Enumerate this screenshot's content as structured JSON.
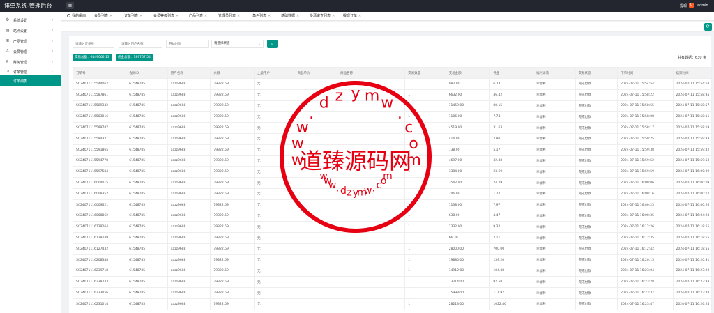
{
  "app": {
    "title": "排单系统-管理后台",
    "notice_label": "提现",
    "notice_count": "0",
    "user": "admin"
  },
  "sidebar": {
    "items": [
      {
        "label": "系统设置",
        "icon": "gear-icon",
        "glyph": "⚙"
      },
      {
        "label": "站点设置",
        "icon": "site-icon",
        "glyph": "▤"
      },
      {
        "label": "产品管理",
        "icon": "product-icon",
        "glyph": "⊞"
      },
      {
        "label": "会员管理",
        "icon": "user-icon",
        "glyph": "♙"
      },
      {
        "label": "财务管理",
        "icon": "finance-icon",
        "glyph": "¥"
      },
      {
        "label": "订单管理",
        "icon": "order-icon",
        "glyph": "⊡"
      }
    ],
    "active_sub": "订单列表"
  },
  "tabs": [
    {
      "label": "我的桌面"
    },
    {
      "label": "会员列表"
    },
    {
      "label": "订单列表"
    },
    {
      "label": "会员等级列表"
    },
    {
      "label": "产品列表"
    },
    {
      "label": "管理员列表"
    },
    {
      "label": "角色列表"
    },
    {
      "label": "基础数据"
    },
    {
      "label": "多源审查列表"
    },
    {
      "label": "提现订单"
    }
  ],
  "filters": {
    "order_no_ph": "请输入订单号",
    "user_ph": "请输入用户名称",
    "time_ph": "开始时间",
    "status_value": "请选择状态"
  },
  "stats": {
    "trade": "交易总额：6449066.13",
    "commission": "佣金总额：189767.54",
    "total": "共有数据：630 条"
  },
  "table": {
    "headers": [
      "订单号",
      "会员ID",
      "用户名称",
      "余额",
      "上级用户",
      "商品单价",
      "商品名称",
      "交易数量",
      "交易金额",
      "佣金",
      "福利详情",
      "交易状态",
      "下单时间",
      "结束时间"
    ],
    "rows": [
      [
        "SC24071115544062",
        "61548785",
        "aazz9688",
        "79322.59",
        "无",
        "",
        "",
        "1",
        "982.00",
        "6.73",
        "幸福利",
        "完成付款",
        "2024-07-11 15:54:54",
        "2024-07-11 15:54:58"
      ],
      [
        "SC24071115587861",
        "61548785",
        "aazz9688",
        "79322.59",
        "无",
        "",
        "",
        "1",
        "6632.00",
        "46.42",
        "幸福利",
        "完成付款",
        "2024-07-11 15:58:22",
        "2024-07-11 15:58:35"
      ],
      [
        "SC24071115589342",
        "61548785",
        "aazz9688",
        "79322.59",
        "无",
        "",
        "",
        "1",
        "11459.00",
        "80.15",
        "幸福利",
        "完成付款",
        "2024-07-11 15:58:55",
        "2024-07-11 15:58:57"
      ],
      [
        "SC24071115583016",
        "61548785",
        "aazz9688",
        "79322.59",
        "无",
        "",
        "",
        "1",
        "1106.00",
        "7.74",
        "幸福利",
        "完成付款",
        "2024-07-11 15:58:08",
        "2024-07-11 15:58:11"
      ],
      [
        "SC24071115589787",
        "61548785",
        "aazz9688",
        "79322.59",
        "无",
        "",
        "",
        "1",
        "4519.00",
        "31.63",
        "幸福利",
        "完成付款",
        "2024-07-11 15:58:17",
        "2024-07-11 15:58:19"
      ],
      [
        "SC24071115594321",
        "61548785",
        "aazz9688",
        "79322.59",
        "无",
        "",
        "",
        "1",
        "414.00",
        "2.90",
        "幸福利",
        "完成付款",
        "2024-07-11 15:59:25",
        "2024-07-11 15:59:33"
      ],
      [
        "SC24071115591865",
        "61548785",
        "aazz9688",
        "79322.59",
        "无",
        "",
        "",
        "1",
        "738.00",
        "5.17",
        "幸福利",
        "完成付款",
        "2024-07-11 15:59:38",
        "2024-07-11 15:59:42"
      ],
      [
        "SC24071115594778",
        "61548785",
        "aazz9688",
        "79322.59",
        "无",
        "",
        "",
        "1",
        "4697.00",
        "32.88",
        "幸福利",
        "完成付款",
        "2024-07-11 15:59:52",
        "2024-07-11 15:59:53"
      ],
      [
        "SC24071115597584",
        "61548785",
        "aazz9688",
        "79322.59",
        "无",
        "",
        "",
        "1",
        "3384.00",
        "23.69",
        "幸福利",
        "完成付款",
        "2024-07-11 15:59:59",
        "2024-07-11 16:00:09"
      ],
      [
        "SC24071116004015",
        "61548785",
        "aazz9688",
        "79322.59",
        "无",
        "",
        "",
        "1",
        "3542.00",
        "24.79",
        "幸福利",
        "完成付款",
        "2024-07-11 16:00:06",
        "2024-07-11 16:00:09"
      ],
      [
        "SC24071116008352",
        "61548785",
        "aazz9688",
        "79322.59",
        "无",
        "",
        "",
        "1",
        "246.00",
        "1.72",
        "幸福利",
        "完成付款",
        "2024-07-11 16:00:16",
        "2024-07-11 16:00:17"
      ],
      [
        "SC24071116009621",
        "61548785",
        "aazz9688",
        "79322.59",
        "无",
        "",
        "",
        "1",
        "1138.00",
        "7.97",
        "幸福利",
        "完成付款",
        "2024-07-11 16:00:23",
        "2024-07-11 16:00:26"
      ],
      [
        "SC24071116008862",
        "61548785",
        "aazz9688",
        "79322.59",
        "无",
        "",
        "",
        "1",
        "638.00",
        "4.47",
        "幸福利",
        "完成付款",
        "2024-07-11 16:00:35",
        "2024-07-11 16:04:28"
      ],
      [
        "SC24071116129264",
        "61548785",
        "aazz9688",
        "79322.59",
        "无",
        "",
        "",
        "1",
        "1332.00",
        "9.32",
        "幸福利",
        "完成付款",
        "2024-07-11 16:12:26",
        "2024-07-11 16:18:55"
      ],
      [
        "SC24071116129249",
        "61548785",
        "aazz9688",
        "79322.59",
        "无",
        "",
        "",
        "1",
        "66.30",
        "2.11",
        "幸福利",
        "完成付款",
        "2024-07-11 16:12:35",
        "2024-07-11 16:18:55"
      ],
      [
        "SC24071116127432",
        "61548785",
        "aazz9688",
        "79322.59",
        "无",
        "",
        "",
        "1",
        "28000.00",
        "700.00",
        "幸福利",
        "完成付款",
        "2024-07-11 16:12:42",
        "2024-07-11 16:18:55"
      ],
      [
        "SC24071116208348",
        "61548785",
        "aazz9688",
        "79322.59",
        "无",
        "",
        "",
        "1",
        "19885.00",
        "139.20",
        "幸福利",
        "完成付款",
        "2024-07-11 16:20:15",
        "2024-07-11 16:20:31"
      ],
      [
        "SC24071116239718",
        "61548785",
        "aazz9688",
        "79322.59",
        "无",
        "",
        "",
        "1",
        "14912.00",
        "104.38",
        "幸福利",
        "完成付款",
        "2024-07-11 16:23:04",
        "2024-07-11 16:23:20"
      ],
      [
        "SC24071116238733",
        "61548785",
        "aazz9688",
        "79322.59",
        "无",
        "",
        "",
        "1",
        "13214.00",
        "92.50",
        "幸福利",
        "完成付款",
        "2024-07-11 16:23:28",
        "2024-07-11 16:23:38"
      ],
      [
        "SC24071116233456",
        "61548785",
        "aazz9688",
        "79322.59",
        "无",
        "",
        "",
        "1",
        "15998.00",
        "111.97",
        "幸福利",
        "完成付款",
        "2024-07-11 16:23:37",
        "2024-07-11 16:23:48"
      ],
      [
        "SC24071116231014",
        "61548785",
        "aazz9688",
        "79322.59",
        "无",
        "",
        "",
        "1",
        "28213.00",
        "1022.46",
        "幸福利",
        "完成付款",
        "2024-07-11 16:23:47",
        "2024-07-11 16:26:24"
      ]
    ]
  },
  "watermark": {
    "text_cn": "道臻源码网",
    "text_top": "www.dzymw.com",
    "text_bottom": "www.dzymw.com",
    "color": "#e60012"
  },
  "colors": {
    "accent": "#009688",
    "topbar": "#23262e",
    "badge": "#ff5722"
  }
}
